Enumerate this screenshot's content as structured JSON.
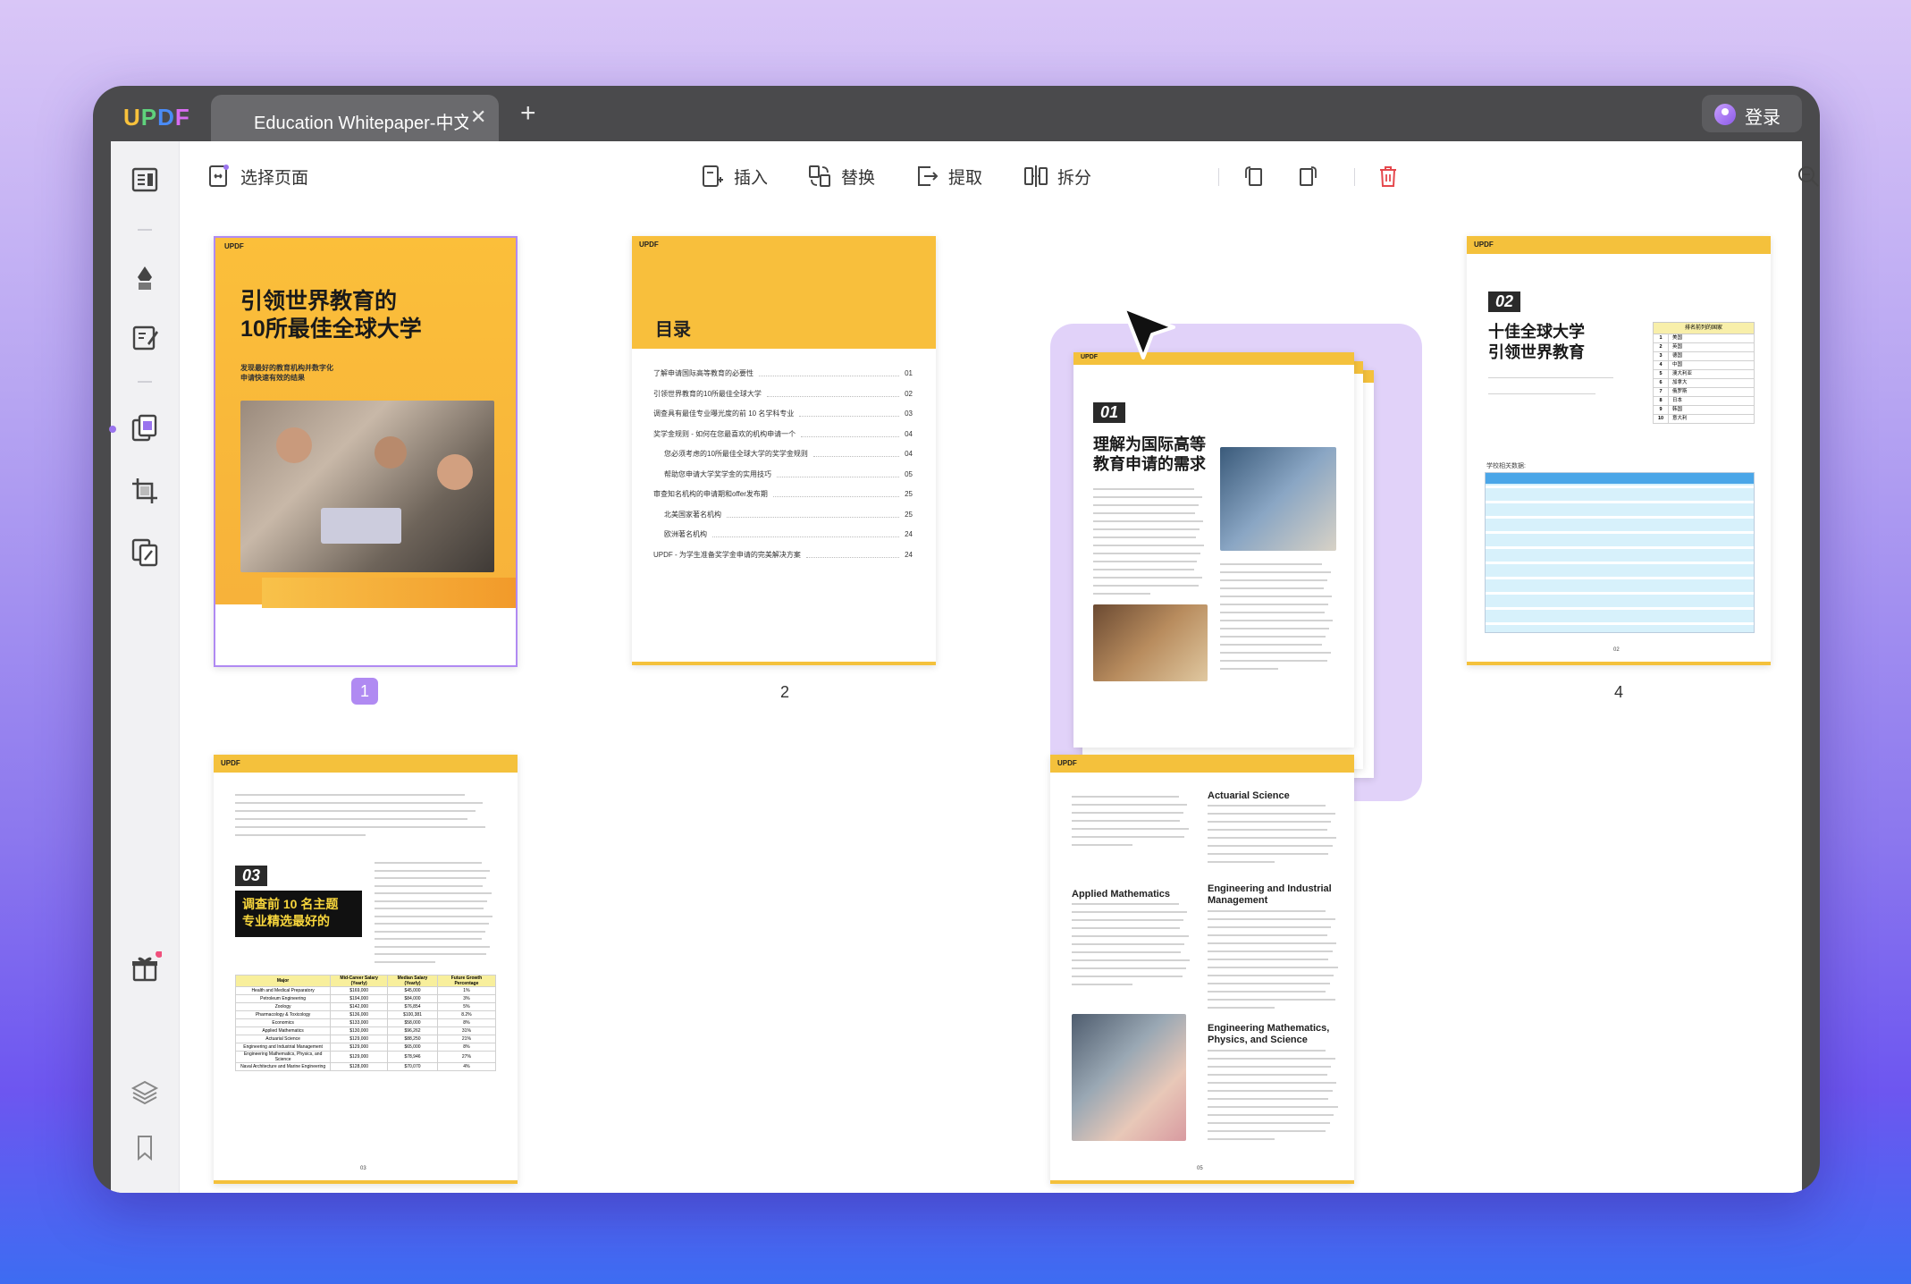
{
  "app": {
    "logo": "UPDF",
    "logo_colors": [
      "#f9c23c",
      "#5fd27c",
      "#4a8cf7",
      "#d86cf2"
    ]
  },
  "tab": {
    "title": "Education Whitepaper-中文",
    "close": "✕",
    "add": "+"
  },
  "login": {
    "label": "登录"
  },
  "toolbar": {
    "select_pages": "选择页面",
    "insert": "插入",
    "replace": "替换",
    "extract": "提取",
    "split": "拆分"
  },
  "pages": {
    "p1": {
      "num": "1",
      "brand": "UPDF",
      "title_l1": "引领世界教育的",
      "title_l2": "10所最佳全球大学",
      "sub_l1": "发现最好的教育机构并数字化",
      "sub_l2": "申请快速有效的结果"
    },
    "p2": {
      "num": "2",
      "brand": "UPDF",
      "title": "目录",
      "toc": [
        {
          "t": "了解申请国际高等教育的必要性",
          "p": "01"
        },
        {
          "t": "引领世界教育的10所最佳全球大学",
          "p": "02"
        },
        {
          "t": "调查具有最佳专业曝光度的前 10 名学科专业",
          "p": "03"
        },
        {
          "t": "奖学金规则 - 如何在您最喜欢的机构申请一个",
          "p": "04"
        },
        {
          "t": "您必须考虑的10所最佳全球大学的奖学金规则",
          "p": "04"
        },
        {
          "t": "帮助您申请大学奖学金的实用技巧",
          "p": "05"
        },
        {
          "t": "审查知名机构的申请期和offer发布期",
          "p": "25"
        },
        {
          "t": "北美国家著名机构",
          "p": "25"
        },
        {
          "t": "欧洲著名机构",
          "p": "24"
        },
        {
          "t": "UPDF - 为学生准备奖学金申请的完美解决方案",
          "p": "24"
        }
      ]
    },
    "p3": {
      "brand": "UPDF",
      "badge": "01",
      "title_l1": "理解为国际高等",
      "title_l2": "教育申请的需求"
    },
    "p4": {
      "num": "4",
      "brand": "UPDF",
      "badge": "02",
      "title_l1": "十佳全球大学",
      "title_l2": "引领世界教育",
      "table_label": "学校相关数据:",
      "rank_header": "排名前列的国家",
      "ranks": [
        "1",
        "2",
        "3",
        "4",
        "5",
        "6",
        "7",
        "8",
        "9",
        "10"
      ],
      "countries": [
        "美国",
        "英国",
        "德国",
        "中国",
        "澳大利亚",
        "加拿大",
        "俄罗斯",
        "日本",
        "韩国",
        "意大利"
      ]
    },
    "p5": {
      "brand": "UPDF",
      "badge": "03",
      "title_l1": "调查前 10 名主题",
      "title_l2": "专业精选最好的",
      "table_headers": [
        "Major",
        "Mid-Career Salary (Yearly)",
        "Median Salary (Yearly)",
        "Future Growth Percentage"
      ],
      "rows": [
        [
          "Health and Medical Preparatory",
          "$169,000",
          "$45,000",
          "1%"
        ],
        [
          "Petroleum Engineering",
          "$194,000",
          "$84,000",
          "3%"
        ],
        [
          "Zoology",
          "$142,000",
          "$76,854",
          "5%"
        ],
        [
          "Pharmacology & Toxicology",
          "$136,000",
          "$100,381",
          "8.2%"
        ],
        [
          "Economics",
          "$133,000",
          "$58,000",
          "8%"
        ],
        [
          "Applied Mathematics",
          "$130,000",
          "$96,262",
          "31%"
        ],
        [
          "Actuarial Science",
          "$129,000",
          "$88,250",
          "21%"
        ],
        [
          "Engineering and Industrial Management",
          "$129,000",
          "$65,000",
          "8%"
        ],
        [
          "Engineering Mathematics, Physics, and Science",
          "$129,000",
          "$78,946",
          "27%"
        ],
        [
          "Naval Architecture and Marine Engineering",
          "$128,000",
          "$70,070",
          "4%"
        ]
      ],
      "footer": "03"
    },
    "p6": {
      "brand": "UPDF",
      "h1": "Actuarial Science",
      "h2": "Applied Mathematics",
      "h3": "Engineering and Industrial Management",
      "h4": "Engineering Mathematics, Physics, and Science",
      "footer": "05"
    }
  }
}
